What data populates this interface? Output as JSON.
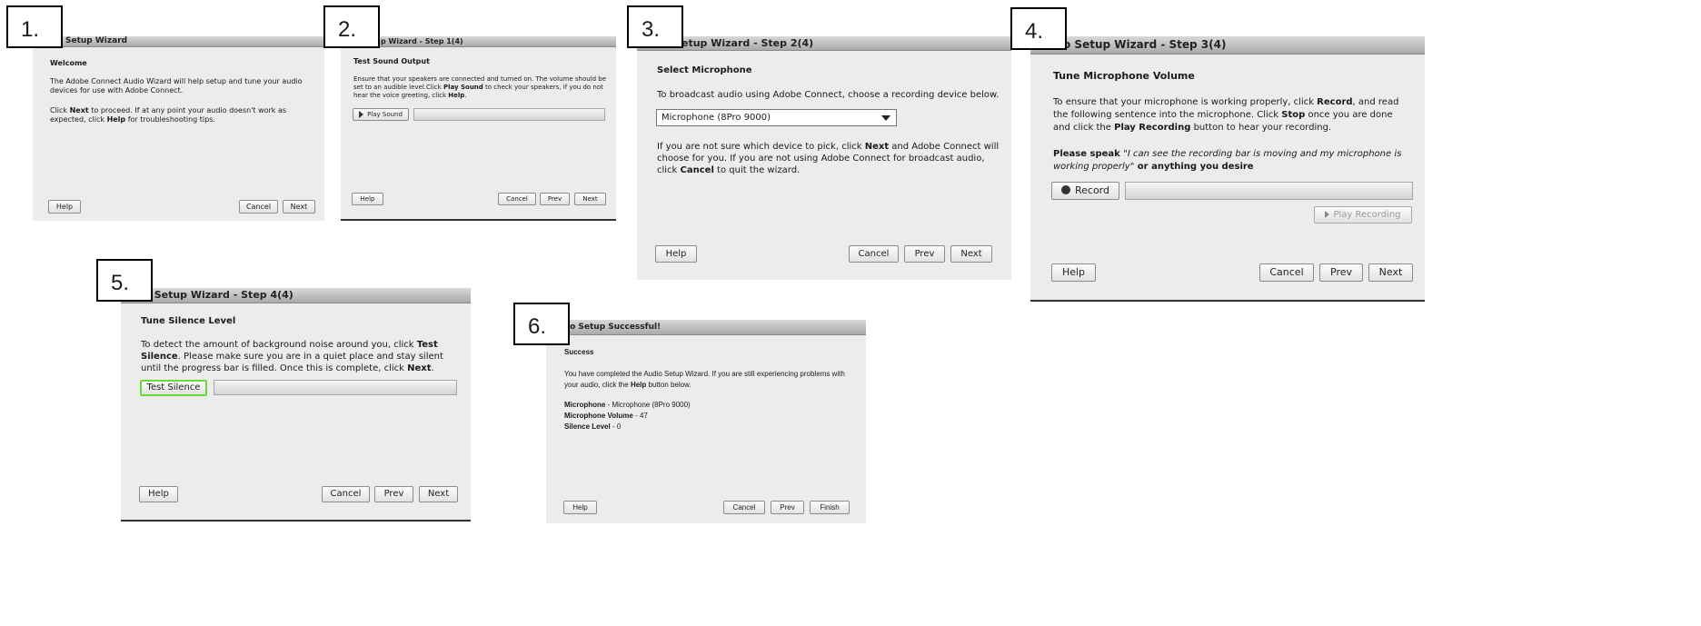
{
  "step_numbers": [
    "1.",
    "2.",
    "3.",
    "4.",
    "5.",
    "6."
  ],
  "panel1": {
    "title": "Setup Wizard",
    "heading": "Welcome",
    "para1": "The Adobe Connect Audio Wizard will help setup and tune your audio devices for use with Adobe Connect.",
    "para2_a": "Click ",
    "para2_b": "Next",
    "para2_c": " to proceed. If at any point your audio doesn't work as expected, click ",
    "para2_d": "Help",
    "para2_e": " for troubleshooting tips.",
    "help_label": "Help",
    "cancel_label": "Cancel",
    "next_label": "Next"
  },
  "panel2": {
    "title": "p Wizard - Step 1(4)",
    "heading": "Test Sound Output",
    "para_a": "Ensure that your speakers are connected and turned on. The volume should be set to an audible level.Click ",
    "para_b": "Play Sound",
    "para_c": " to check your speakers, if you do not hear the voice greeting, click ",
    "para_d": "Help",
    "para_e": ".",
    "play_label": "Play Sound",
    "help_label": "Help",
    "cancel_label": "Cancel",
    "prev_label": "Prev",
    "next_label": "Next"
  },
  "panel3": {
    "title": "etup Wizard - Step 2(4)",
    "heading": "Select Microphone",
    "para1": "To broadcast audio using Adobe Connect, choose a recording device below.",
    "microphone_selected": "Microphone (8Pro 9000)",
    "para2_a": "If you are not sure which device to pick, click ",
    "para2_b": "Next",
    "para2_c": " and Adobe Connect will choose for you. If you are not using Adobe Connect for broadcast audio, click ",
    "para2_d": "Cancel",
    "para2_e": " to quit the wizard.",
    "help_label": "Help",
    "cancel_label": "Cancel",
    "prev_label": "Prev",
    "next_label": "Next"
  },
  "panel4": {
    "title": "o Setup Wizard - Step 3(4)",
    "heading": "Tune Microphone Volume",
    "para1_a": "To ensure that your microphone is working properly, click ",
    "para1_b": "Record",
    "para1_c": ", and read the following sentence into the microphone. Click ",
    "para1_d": "Stop",
    "para1_e": " once you are done and click the ",
    "para1_f": "Play Recording",
    "para1_g": " button to hear your recording.",
    "speak_a": "Please speak ",
    "speak_b": "\"I can see the recording bar is moving and my microphone is working properly\"",
    "speak_c": " or anything you desire",
    "record_label": "Record",
    "play_recording_label": "Play Recording",
    "help_label": "Help",
    "cancel_label": "Cancel",
    "prev_label": "Prev",
    "next_label": "Next"
  },
  "panel5": {
    "title": "p Setup Wizard - Step 4(4)",
    "heading": "Tune Silence Level",
    "para_a": "To detect the amount of background noise around you, click ",
    "para_b": "Test Silence",
    "para_c": ". Please make sure you are in a quiet place and stay silent until the progress bar is filled. Once this is complete, click ",
    "para_d": "Next",
    "para_e": ".",
    "test_silence_label": "Test Silence",
    "help_label": "Help",
    "cancel_label": "Cancel",
    "prev_label": "Prev",
    "next_label": "Next"
  },
  "panel6": {
    "title": "io Setup Successful!",
    "heading": "Success",
    "para_a": "You have completed the Audio Setup Wizard. If you are still experiencing problems with your audio, click the ",
    "para_b": "Help",
    "para_c": " button below.",
    "mic_label": "Microphone",
    "mic_value": " - Microphone (8Pro 9000)",
    "vol_label": "Microphone Volume",
    "vol_value": " - 47",
    "silence_label": "Silence Level",
    "silence_value": " - 0",
    "help_label": "Help",
    "cancel_label": "Cancel",
    "prev_label": "Prev",
    "finish_label": "Finish"
  },
  "colors": {
    "panel_bg": "#ececec",
    "focus_green": "#66dd33"
  }
}
